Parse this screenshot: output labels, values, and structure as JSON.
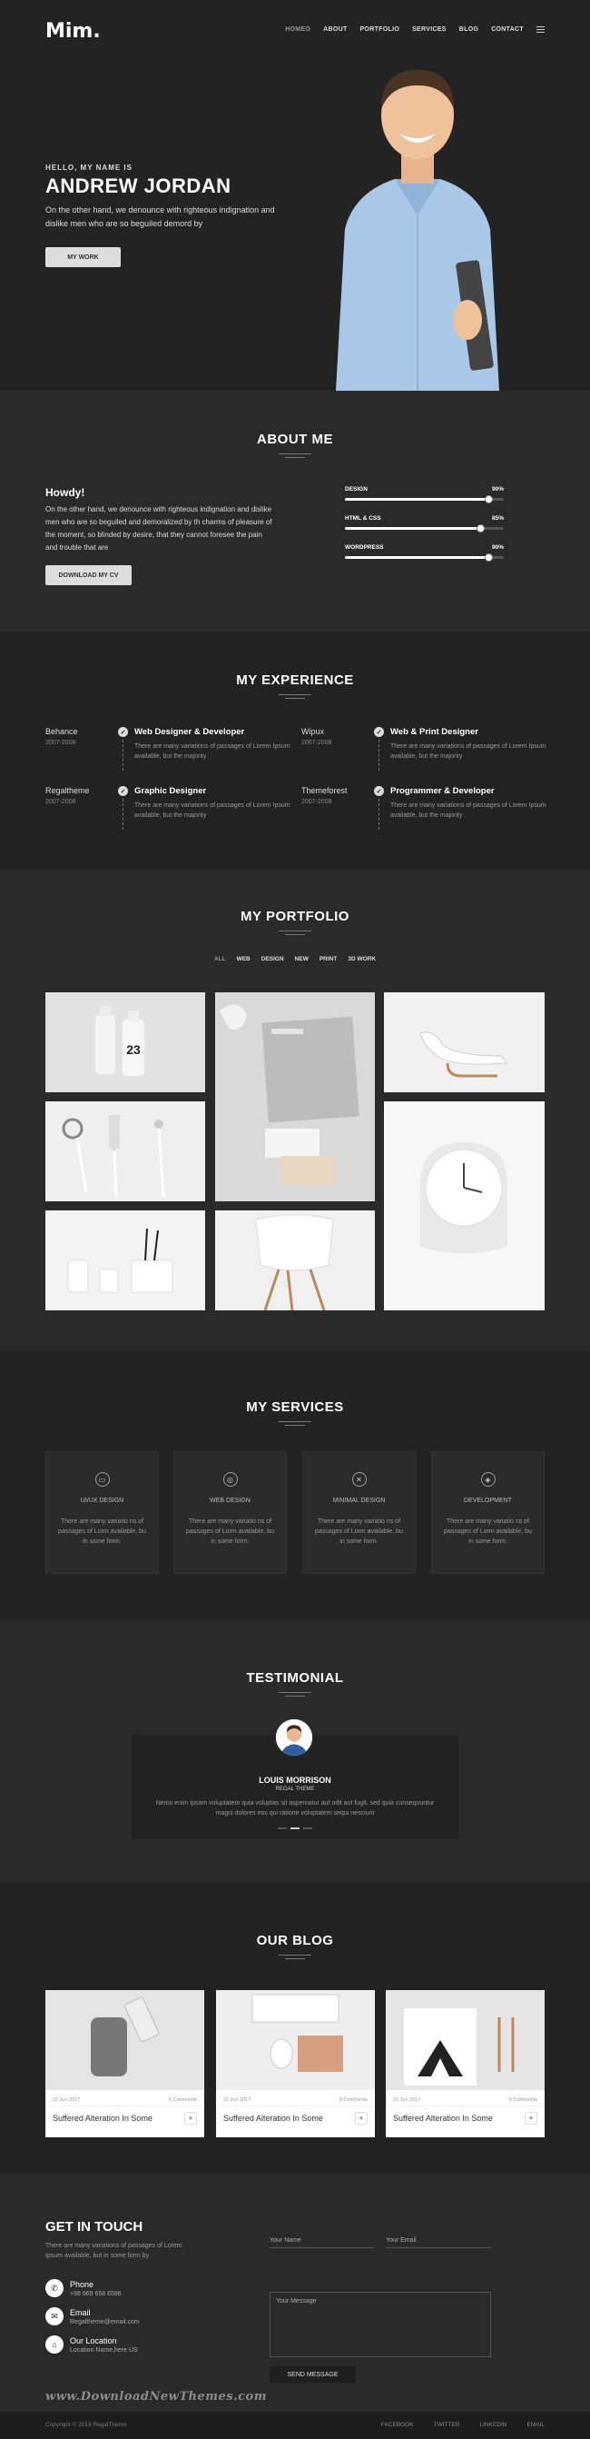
{
  "header": {
    "logo": "Mim.",
    "nav": [
      "HOMEO",
      "ABOUT",
      "PORTFOLIO",
      "SERVICES",
      "BLOG",
      "CONTACT"
    ]
  },
  "hero": {
    "hello": "HELLO, MY NAME IS",
    "name": "ANDREW JORDAN",
    "description": "On the other hand, we denounce with righteous indignation and dislike men who are so beguiled demord by",
    "button": "MY WORK"
  },
  "about": {
    "title": "ABOUT ME",
    "greeting": "Howdy!",
    "description": "On the other hand, we denounce with righteous indignation and dislike men who are so beguiled and demoralized by th charms of pleasure of the moment, so blinded by desire, that they cannot foresee the pain and trouble that are",
    "button": "DOWNLOAD MY CV",
    "skills": [
      {
        "name": "DESIGN",
        "percent_label": "90%",
        "level": 0.9
      },
      {
        "name": "HTML & CSS",
        "percent_label": "85%",
        "level": 0.85
      },
      {
        "name": "WORDPRESS",
        "percent_label": "90%",
        "level": 0.9
      }
    ]
  },
  "experience": {
    "title": "MY EXPERIENCE",
    "items": [
      {
        "org": "Behance",
        "years": "2007-2008",
        "role": "Web Designer & Developer",
        "text": "There are many variations of passages of Lorem Ipsum available, but the majority"
      },
      {
        "org": "Wipux",
        "years": "2007-2008",
        "role": "Web & Print Designer",
        "text": "There are many variations of passages of Lorem Ipsum available, but the majority"
      },
      {
        "org": "Regaltheme",
        "years": "2007-2008",
        "role": "Graphic Designer",
        "text": "There are many variations of passages of Lorem Ipsum available, but the majority"
      },
      {
        "org": "Themeforest",
        "years": "2007-2008",
        "role": "Programmer & Developer",
        "text": "There are many variations of passages of Lorem Ipsum available, but the majority"
      }
    ]
  },
  "portfolio": {
    "title": "MY PORTFOLIO",
    "filters": [
      "ALL",
      "WEB",
      "DESIGN",
      "NEW",
      "PRINT",
      "3D WORK"
    ],
    "bottle_label": "23"
  },
  "services": {
    "title": "MY SERVICES",
    "items": [
      {
        "icon": "laptop-icon",
        "name": "UI/UX DESIGN",
        "text": "There are many variatio ns of passages of Lorm available, bu in some form."
      },
      {
        "icon": "globe-icon",
        "name": "WEB DESIGN",
        "text": "There are many variatio ns of passages of Lorm available, bu in some form."
      },
      {
        "icon": "tools-icon",
        "name": "MINIMAL DESIGN",
        "text": "There are many variatio ns of passages of Lorm available, bu in some form."
      },
      {
        "icon": "shield-icon",
        "name": "DEVELOPMENT",
        "text": "There are many variatio ns of passages of Lorm available, bu in some form."
      }
    ]
  },
  "testimonial": {
    "title": "TESTIMONIAL",
    "name": "LOUIS MORRISON",
    "role": "REGAL THEME",
    "quote": "Nemo enim ipsam voluptatem quia voluptas sit aspernatur aut odit aut fugit, sed quia consequuntur magni dolores eos qui ratione voluptatem sequi nesciunt"
  },
  "blog": {
    "title": "OUR BLOG",
    "posts": [
      {
        "date": "22 Jun 2017",
        "comments": "5 Comments",
        "title": "Suffered Alteration In Some"
      },
      {
        "date": "22 Jun 2017",
        "comments": "5 Comments",
        "title": "Suffered Alteration In Some"
      },
      {
        "date": "22 Jun 2017",
        "comments": "5 Comments",
        "title": "Suffered Alteration In Some"
      }
    ]
  },
  "contact": {
    "title": "GET IN TOUCH",
    "text": "There are many variations of passages of Lorem Ipsum available, but in some form by",
    "phone_label": "Phone",
    "phone_value": "+88 669 658 6586",
    "email_label": "Email",
    "email_value": "Regaltheme@email.com",
    "location_label": "Our Location",
    "location_value": "Location Name,here US",
    "name_placeholder": "Your Name",
    "email_placeholder": "Your Email",
    "message_placeholder": "Your Message",
    "send_button": "SEND MESSAGE",
    "watermark": "www.DownloadNewThemes.com"
  },
  "footer": {
    "copyright": "Copyright © 2018 RegalTheme",
    "socials": [
      "FACEBOOK",
      "TWITTER",
      "LINKEDIN",
      "EMAIL"
    ]
  }
}
